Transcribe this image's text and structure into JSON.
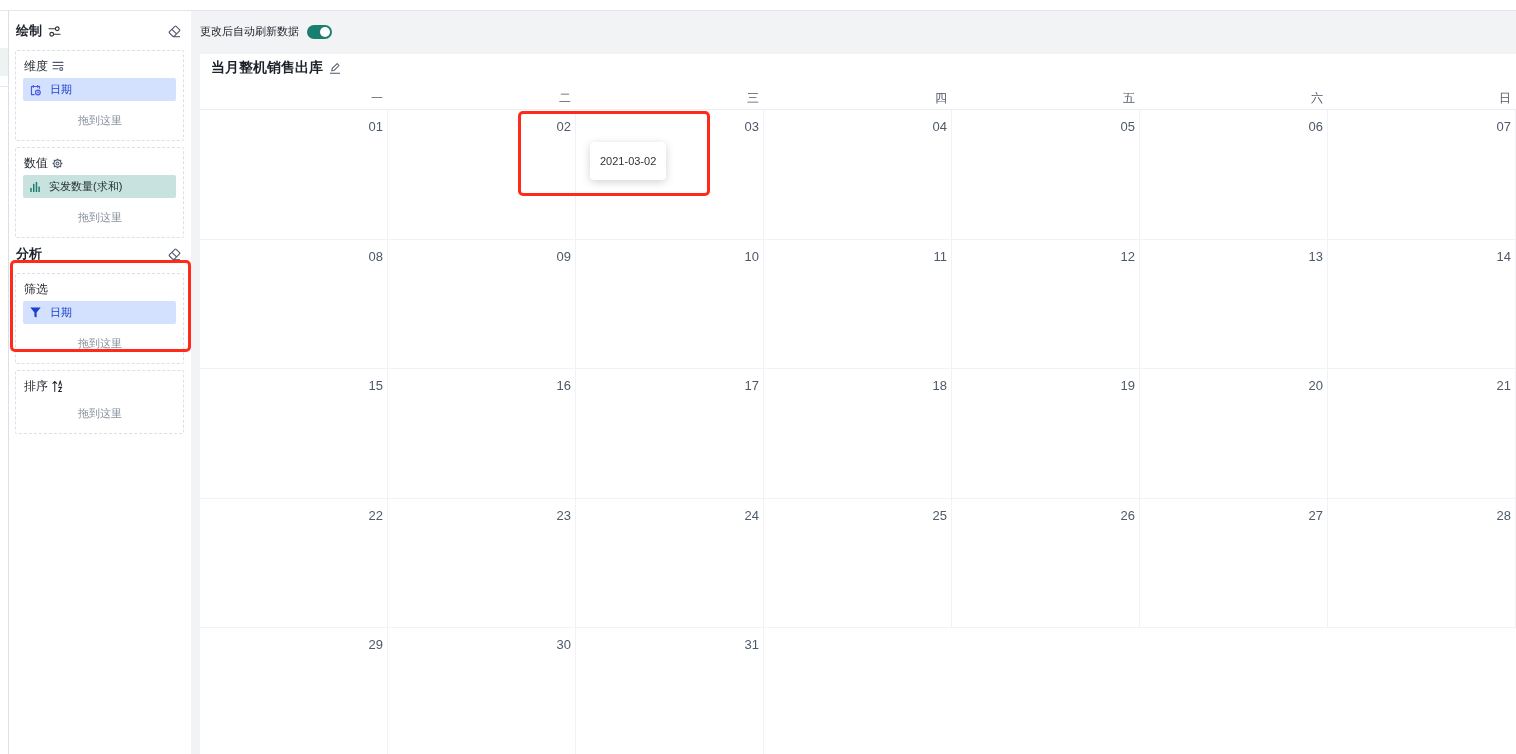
{
  "left_panel": {
    "rows": [
      {
        "selected": true
      }
    ]
  },
  "sidebar": {
    "groups": [
      {
        "kind": "plot",
        "title": "绘制",
        "sections": [
          {
            "kind": "dimension",
            "title": "维度",
            "highlighted": false,
            "fields": [
              {
                "label": "日期"
              }
            ],
            "drop_hint": "拖到这里"
          },
          {
            "kind": "measure",
            "title": "数值",
            "highlighted": false,
            "fields": [
              {
                "label": "实发数量(求和)"
              }
            ],
            "drop_hint": "拖到这里"
          }
        ]
      },
      {
        "kind": "analysis",
        "title": "分析",
        "sections": [
          {
            "kind": "filter",
            "title": "筛选",
            "highlighted": true,
            "fields": [
              {
                "label": "日期"
              }
            ],
            "drop_hint": "拖到这里"
          },
          {
            "kind": "sort",
            "title": "排序",
            "highlighted": false,
            "drop_hint": "拖到这里"
          }
        ]
      }
    ]
  },
  "top_toolbar": {
    "auto_refresh_label": "更改后自动刷新数据",
    "auto_refresh_on": true
  },
  "calendar": {
    "title": "当月整机销售出库",
    "weekdays": [
      "一",
      "二",
      "三",
      "四",
      "五",
      "六",
      "日"
    ],
    "days": [
      {
        "label": "01"
      },
      {
        "label": "02",
        "tooltip": {
          "text": "2021-03-02",
          "highlighted": true
        }
      },
      {
        "label": "03"
      },
      {
        "label": "04"
      },
      {
        "label": "05"
      },
      {
        "label": "06"
      },
      {
        "label": "07"
      },
      {
        "label": "08"
      },
      {
        "label": "09"
      },
      {
        "label": "10"
      },
      {
        "label": "11"
      },
      {
        "label": "12"
      },
      {
        "label": "13"
      },
      {
        "label": "14"
      },
      {
        "label": "15"
      },
      {
        "label": "16"
      },
      {
        "label": "17"
      },
      {
        "label": "18"
      },
      {
        "label": "19"
      },
      {
        "label": "20"
      },
      {
        "label": "21"
      },
      {
        "label": "22"
      },
      {
        "label": "23"
      },
      {
        "label": "24"
      },
      {
        "label": "25"
      },
      {
        "label": "26"
      },
      {
        "label": "27"
      },
      {
        "label": "28"
      },
      {
        "label": "29"
      },
      {
        "label": "30"
      },
      {
        "label": "31"
      }
    ]
  }
}
